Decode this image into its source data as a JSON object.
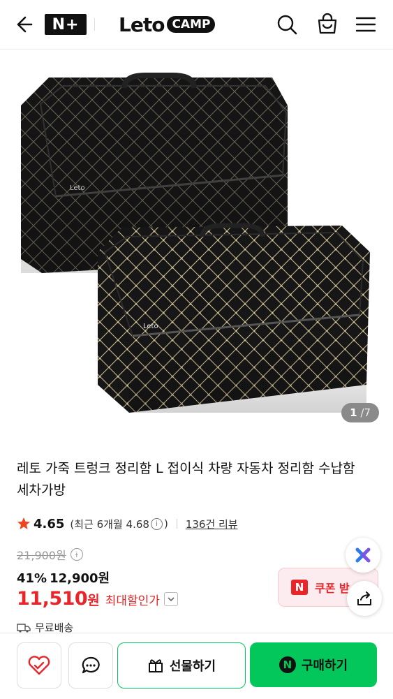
{
  "header": {
    "back_icon": "back-arrow-icon",
    "badge": "N+",
    "brand": "Leto",
    "brand_tag": "CAMP",
    "icons": [
      "search-icon",
      "shopping-bag-icon",
      "menu-icon"
    ]
  },
  "gallery": {
    "current": "1",
    "separator": "/",
    "total": "7",
    "logo_text": "Leto"
  },
  "product": {
    "title": "레토 가죽 트렁크 정리함 L 접이식 차량 자동차 정리함 수납함 세차가방",
    "rating": "4.65",
    "recent_rating": "(최근 6개월 4.68",
    "recent_close": ")",
    "review_count": "136건 리뷰",
    "original_price": "21,900원",
    "discount_rate": "41%",
    "discount_price": "12,900원",
    "final_price_num": "11,510",
    "final_price_unit": "원",
    "final_price_label": "최대할인가",
    "shipping": "무료배송"
  },
  "coupon": {
    "badge": "N",
    "label": "쿠폰 받"
  },
  "bottom": {
    "gift_label": "선물하기",
    "buy_badge": "N",
    "buy_label": "구매하기"
  },
  "colors": {
    "accent_green": "#03c75a",
    "price_red": "#e8262a",
    "star": "#f0441f"
  }
}
